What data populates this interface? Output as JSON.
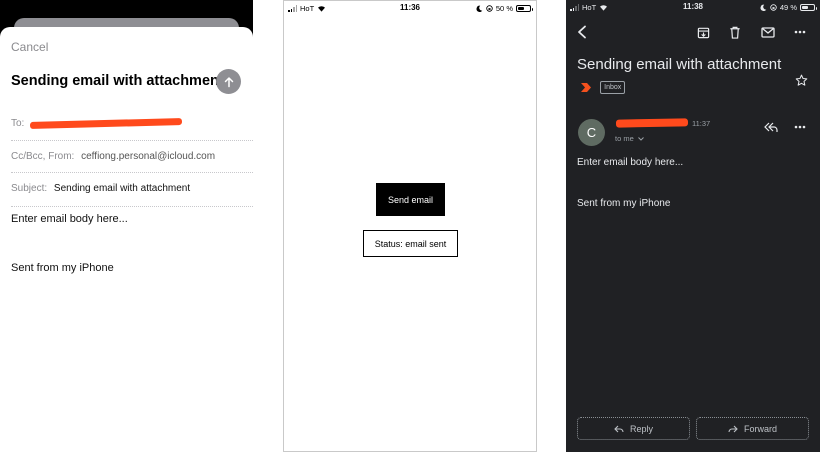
{
  "compose": {
    "cancel_label": "Cancel",
    "title": "Sending email with attachment",
    "to_label": "To:",
    "ccbcc_label": "Cc/Bcc, From:",
    "from_value": "ceffiong.personal@icloud.com",
    "subject_label": "Subject:",
    "subject_value": "Sending email with attachment",
    "body_line1": "Enter email body here...",
    "body_line2": "Sent from my iPhone"
  },
  "app": {
    "status_bar": {
      "carrier": "HoT",
      "time": "11:36",
      "battery": "50 %"
    },
    "send_button_label": "Send email",
    "status_text": "Status: email sent"
  },
  "gmail": {
    "status_bar": {
      "carrier": "HoT",
      "time": "11:38",
      "battery": "49 %"
    },
    "subject": "Sending email with attachment",
    "label_chip": "Inbox",
    "avatar_letter": "C",
    "sent_time": "11:37",
    "to_me": "to me",
    "body_line1": "Enter email body here...",
    "body_line2": "Sent from my iPhone",
    "reply_label": "Reply",
    "forward_label": "Forward"
  },
  "colors": {
    "redaction": "#ff4a1c",
    "gmail_background": "#202124",
    "important_marker": "#f4511e"
  },
  "icons": [
    "arrow-up-icon",
    "signal-icon",
    "wifi-icon",
    "moon-icon",
    "lock-rotation-icon",
    "battery-icon",
    "back-arrow-icon",
    "archive-icon",
    "trash-icon",
    "mail-icon",
    "more-icon",
    "star-icon",
    "reply-icon",
    "forward-icon",
    "chevron-down-icon"
  ]
}
